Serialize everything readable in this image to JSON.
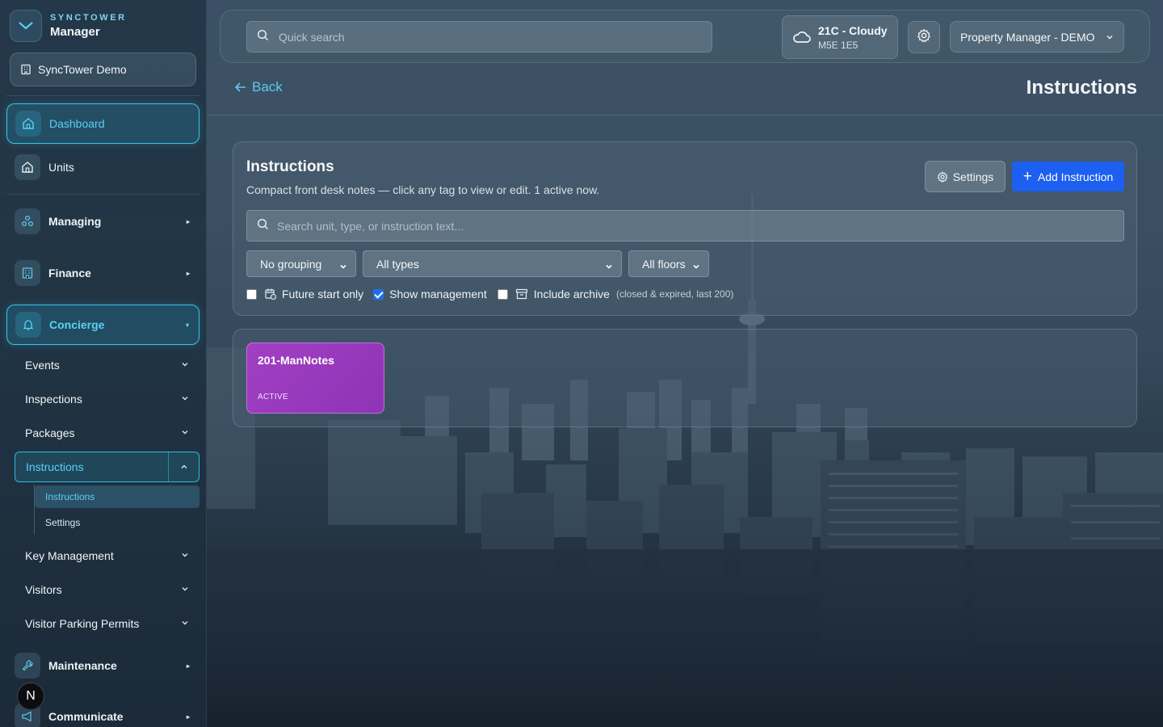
{
  "brand": {
    "top": "SYNCTOWER",
    "name": "Manager"
  },
  "building": "SyncTower Demo",
  "sidebar": {
    "dashboard": "Dashboard",
    "units": "Units",
    "managing": "Managing",
    "finance": "Finance",
    "concierge": "Concierge",
    "events": "Events",
    "inspections": "Inspections",
    "packages": "Packages",
    "instructions": "Instructions",
    "instructions_sub": "Instructions",
    "settings_sub": "Settings",
    "key_management": "Key Management",
    "visitors": "Visitors",
    "visitor_parking": "Visitor Parking Permits",
    "maintenance": "Maintenance",
    "communicate": "Communicate",
    "badge": "N"
  },
  "topbar": {
    "search_placeholder": "Quick search",
    "weather_main": "21C - Cloudy",
    "weather_sub": "M5E 1E5",
    "user": "Property Manager - DEMO"
  },
  "header": {
    "back": "Back",
    "title": "Instructions"
  },
  "panel": {
    "title": "Instructions",
    "description": "Compact front desk notes — click any tag to view or edit. 1 active now.",
    "settings_label": "Settings",
    "add_label": "Add Instruction",
    "search_placeholder": "Search unit, type, or instruction text...",
    "grouping": "No grouping",
    "types": "All types",
    "floors": "All floors",
    "future_only": "Future start only",
    "show_management": "Show management",
    "include_archive": "Include archive",
    "archive_note": "(closed & expired, last 200)",
    "future_checked": false,
    "management_checked": true,
    "archive_checked": false
  },
  "tags": [
    {
      "name": "201-ManNotes",
      "status": "ACTIVE",
      "color": "#a23fc4"
    }
  ],
  "colors": {
    "accent": "#39c3e8",
    "primary": "#1d5ff0"
  }
}
